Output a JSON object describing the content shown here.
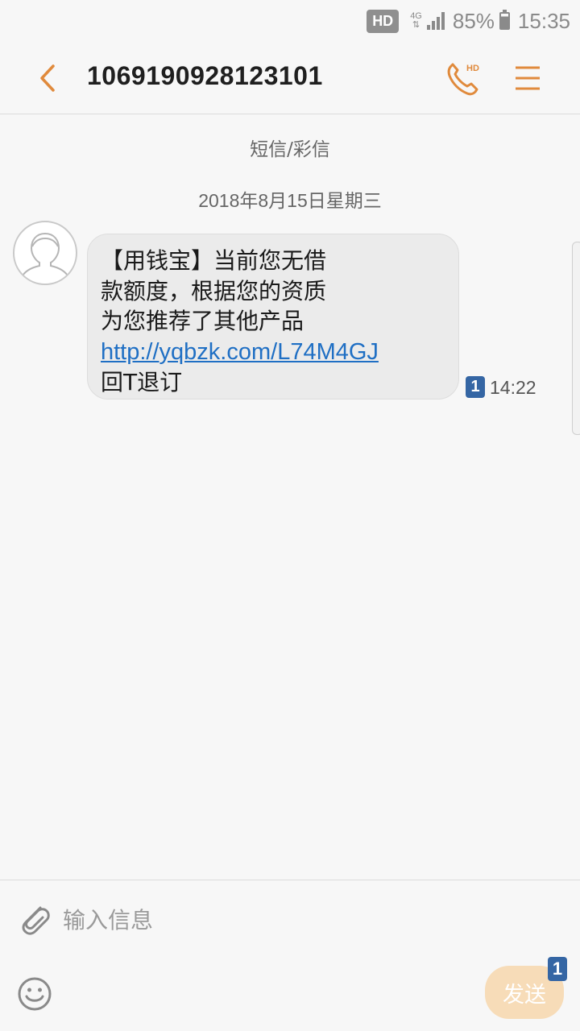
{
  "status_bar": {
    "hd": "HD",
    "network": "4G",
    "battery": "85%",
    "time": "15:35"
  },
  "header": {
    "contact": "1069190928123101",
    "back_icon": "chevron-left-icon",
    "call_icon": "hd-phone-icon",
    "call_badge": "HD",
    "menu_icon": "hamburger-menu-icon",
    "accent_color": "#e08a3c"
  },
  "conversation": {
    "type_label": "短信/彩信",
    "date_label": "2018年8月15日星期三",
    "messages": [
      {
        "lines": [
          "【用钱宝】当前您无借",
          "款额度，根据您的资质",
          "为您推荐了其他产品"
        ],
        "link": "http://yqbzk.com/L74M4GJ",
        "tail": "回T退订",
        "sim": "1",
        "time": "14:22"
      }
    ]
  },
  "composer": {
    "placeholder": "输入信息",
    "send_label": "发送",
    "send_sim": "1",
    "attach_icon": "paperclip-icon",
    "emoji_icon": "smiley-icon"
  }
}
